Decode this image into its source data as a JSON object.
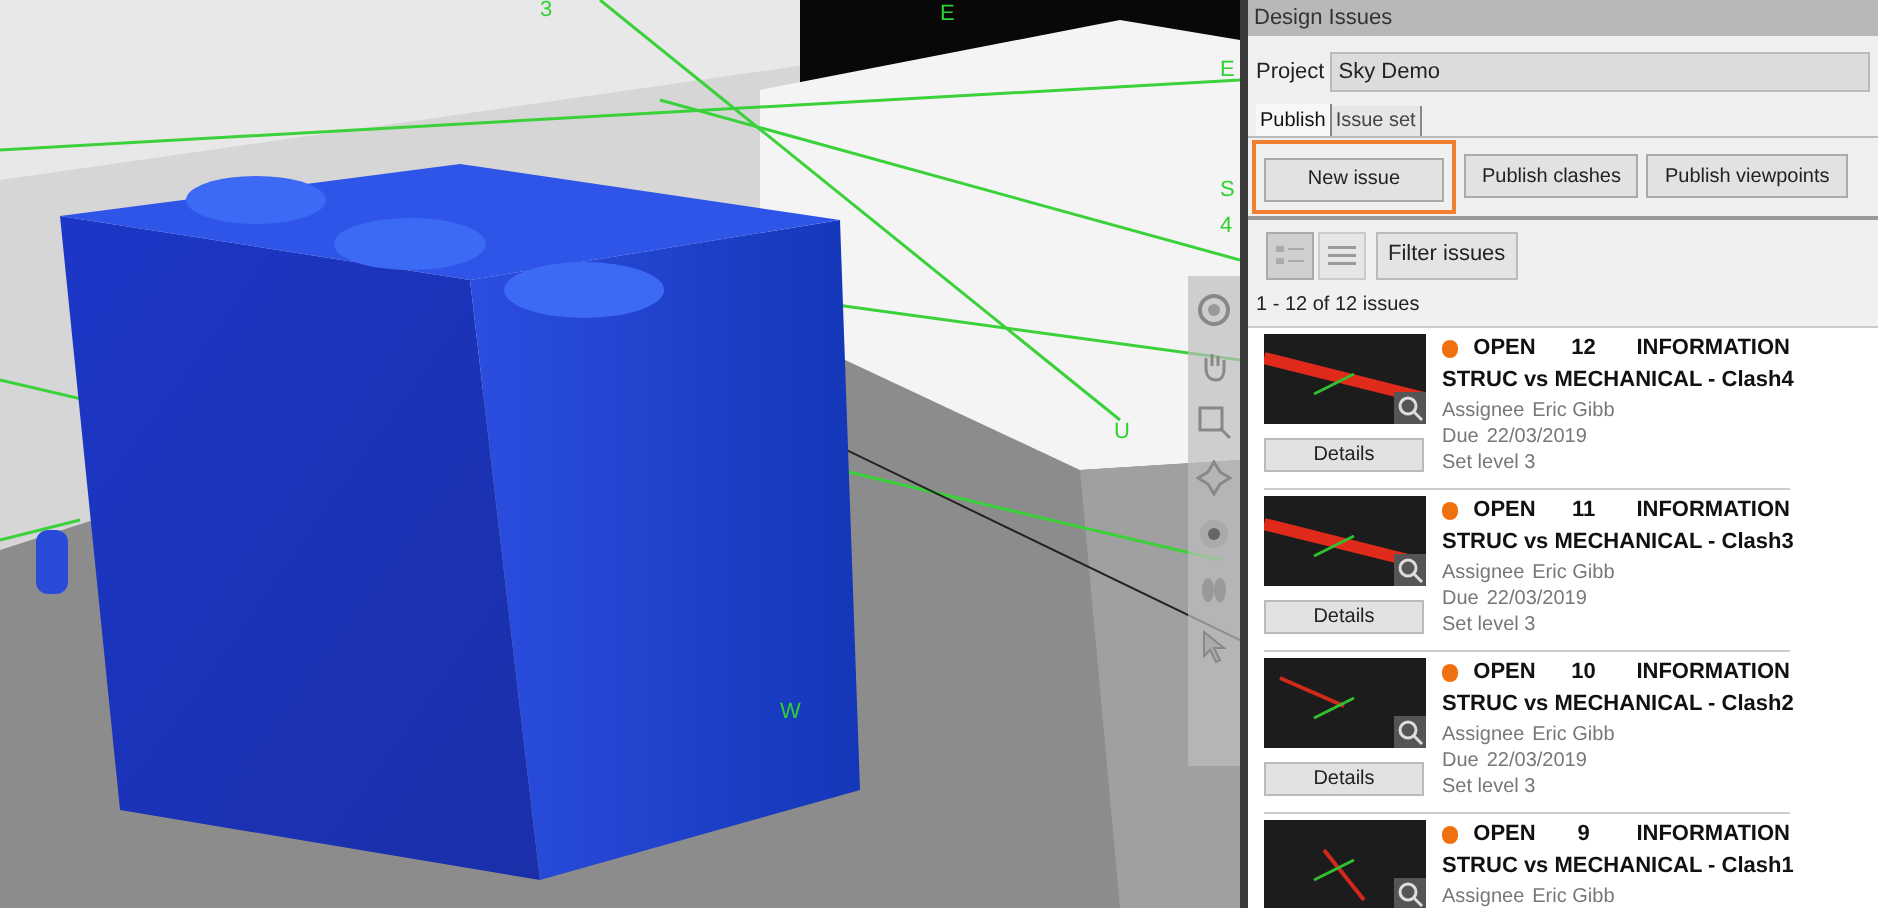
{
  "viewport": {
    "grid_labels": [
      "3",
      "E",
      "E",
      "S",
      "4",
      "U",
      "W"
    ]
  },
  "panel": {
    "title": "Design Issues",
    "project_label": "Project",
    "project_value": "Sky Demo",
    "tabs": [
      {
        "label": "Publish",
        "selected": true
      },
      {
        "label": "Issue set",
        "selected": false
      }
    ],
    "actions": [
      {
        "label": "New issue",
        "highlighted": true
      },
      {
        "label": "Publish clashes",
        "highlighted": false
      },
      {
        "label": "Publish viewpoints",
        "highlighted": false
      }
    ],
    "view_toggles": [
      {
        "selected": true
      },
      {
        "selected": false
      }
    ],
    "filter_button": "Filter issues",
    "count": "1 - 12 of 12 issues",
    "issues": [
      {
        "color": "#f07010",
        "status": "OPEN",
        "number": "12",
        "type": "INFORMATION",
        "title": "STRUC vs MECHANICAL - Clash4",
        "assignee_label": "Assignee",
        "assignee": "Eric Gibb",
        "due_label": "Due",
        "due": "22/03/2019",
        "level": "Set level 3",
        "button": "Details"
      },
      {
        "color": "#f07010",
        "status": "OPEN",
        "number": "11",
        "type": "INFORMATION",
        "title": "STRUC vs MECHANICAL - Clash3",
        "assignee_label": "Assignee",
        "assignee": "Eric Gibb",
        "due_label": "Due",
        "due": "22/03/2019",
        "level": "Set level 3",
        "button": "Details"
      },
      {
        "color": "#f07010",
        "status": "OPEN",
        "number": "10",
        "type": "INFORMATION",
        "title": "STRUC vs MECHANICAL - Clash2",
        "assignee_label": "Assignee",
        "assignee": "Eric Gibb",
        "due_label": "Due",
        "due": "22/03/2019",
        "level": "Set level 3",
        "button": "Details"
      },
      {
        "color": "#f07010",
        "status": "OPEN",
        "number": "9",
        "type": "INFORMATION",
        "title": "STRUC vs MECHANICAL - Clash1",
        "assignee_label": "Assignee",
        "assignee": "Eric Gibb"
      }
    ]
  }
}
